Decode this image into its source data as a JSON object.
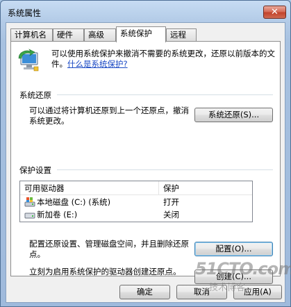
{
  "window": {
    "title": "系统属性",
    "close_glyph": "✕"
  },
  "tabs": [
    {
      "label": "计算机名"
    },
    {
      "label": "硬件"
    },
    {
      "label": "高级"
    },
    {
      "label": "系统保护",
      "active": true
    },
    {
      "label": "远程"
    }
  ],
  "intro": {
    "icon": "system-protection-icon",
    "text": "可以使用系统保护来撤消不需要的系统更改，还原以前版本的文件。",
    "link": "什么是系统保护?"
  },
  "restore": {
    "group_label": "系统还原",
    "description": "可以通过将计算机还原到上一个还原点，撤消系统更改。",
    "button": "系统还原(S)..."
  },
  "protection": {
    "group_label": "保护设置",
    "columns": [
      "可用驱动器",
      "保护"
    ],
    "drives": [
      {
        "icon": "local-disk-icon",
        "name": "本地磁盘 (C:) (系统)",
        "protection": "打开"
      },
      {
        "icon": "drive-icon",
        "name": "新加卷 (E:)",
        "protection": "关闭"
      }
    ],
    "configure_text": "配置还原设置、管理磁盘空间，并且删除还原点。",
    "configure_button": "配置(O)...",
    "create_text": "立刻为启用系统保护的驱动器创建还原点。",
    "create_button": "创建(C)..."
  },
  "footer": {
    "ok": "确定",
    "cancel": "取消",
    "apply": "应用(A)"
  },
  "watermark": {
    "line1": "51CTO.com",
    "line2": "技术博客"
  }
}
